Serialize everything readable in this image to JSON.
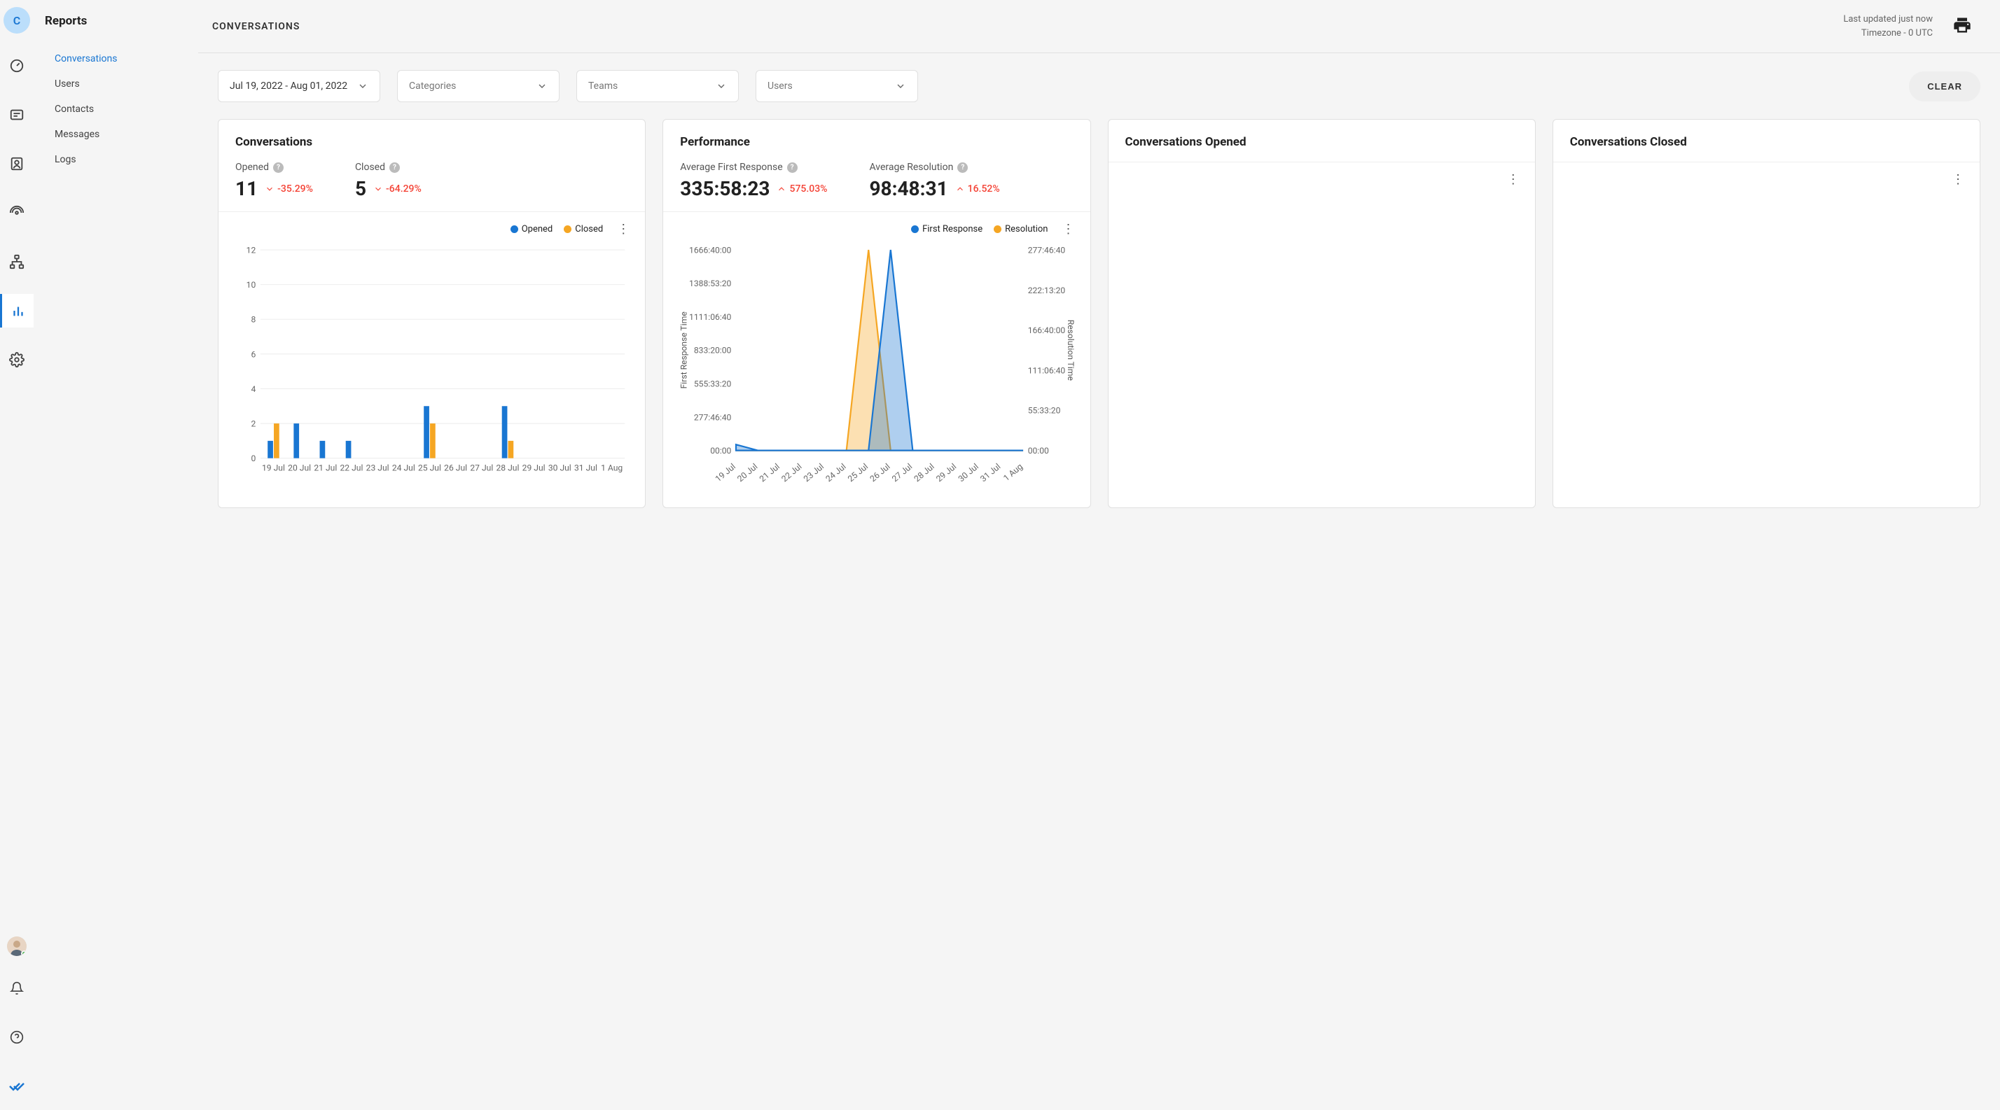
{
  "avatar_letter": "C",
  "sidebar_title": "Reports",
  "sidebar_items": [
    "Conversations",
    "Users",
    "Contacts",
    "Messages",
    "Logs"
  ],
  "page_title": "CONVERSATIONS",
  "header": {
    "updated": "Last updated just now",
    "timezone": "Timezone - 0 UTC"
  },
  "filters": {
    "date_range": "Jul 19, 2022 - Aug 01, 2022",
    "categories": "Categories",
    "teams": "Teams",
    "users": "Users",
    "clear_label": "CLEAR"
  },
  "conversations_card": {
    "title": "Conversations",
    "opened_label": "Opened",
    "opened_value": "11",
    "opened_delta": "-35.29%",
    "opened_dir": "down",
    "closed_label": "Closed",
    "closed_value": "5",
    "closed_delta": "-64.29%",
    "closed_dir": "down",
    "legend_opened": "Opened",
    "legend_closed": "Closed"
  },
  "performance_card": {
    "title": "Performance",
    "afr_label": "Average First Response",
    "afr_value": "335:58:23",
    "afr_delta": "575.03%",
    "afr_dir": "up",
    "ar_label": "Average Resolution",
    "ar_value": "98:48:31",
    "ar_delta": "16.52%",
    "ar_dir": "up",
    "legend_fr": "First Response",
    "legend_res": "Resolution",
    "y_left_title": "First Response Time",
    "y_right_title": "Resolution Time"
  },
  "card3_title": "Conversations Opened",
  "card4_title": "Conversations Closed",
  "colors": {
    "blue": "#1976d2",
    "orange": "#f5a623",
    "red": "#f44336"
  },
  "chart_data": [
    {
      "type": "bar",
      "title": "Conversations",
      "categories": [
        "19 Jul",
        "20 Jul",
        "21 Jul",
        "22 Jul",
        "23 Jul",
        "24 Jul",
        "25 Jul",
        "26 Jul",
        "27 Jul",
        "28 Jul",
        "29 Jul",
        "30 Jul",
        "31 Jul",
        "1 Aug"
      ],
      "series": [
        {
          "name": "Opened",
          "color": "#1976d2",
          "values": [
            1,
            2,
            1,
            1,
            0,
            0,
            3,
            0,
            0,
            3,
            0,
            0,
            0,
            0
          ]
        },
        {
          "name": "Closed",
          "color": "#f5a623",
          "values": [
            2,
            0,
            0,
            0,
            0,
            0,
            2,
            0,
            0,
            1,
            0,
            0,
            0,
            0
          ]
        }
      ],
      "ylim": [
        0,
        12
      ],
      "yticks": [
        0,
        2,
        4,
        6,
        8,
        10,
        12
      ]
    },
    {
      "type": "area",
      "title": "Performance",
      "categories": [
        "19 Jul",
        "20 Jul",
        "21 Jul",
        "22 Jul",
        "23 Jul",
        "24 Jul",
        "25 Jul",
        "26 Jul",
        "27 Jul",
        "28 Jul",
        "29 Jul",
        "30 Jul",
        "31 Jul",
        "1 Aug"
      ],
      "series": [
        {
          "name": "First Response",
          "axis": "left",
          "color": "#1976d2",
          "values": [
            50,
            0,
            0,
            0,
            0,
            0,
            0,
            1700,
            0,
            0,
            0,
            0,
            0,
            0
          ]
        },
        {
          "name": "Resolution",
          "axis": "right",
          "color": "#f5a623",
          "values": [
            0,
            0,
            0,
            0,
            0,
            0,
            280,
            0,
            0,
            0,
            0,
            0,
            0,
            0
          ]
        }
      ],
      "y_left_ticks": [
        "00:00",
        "277:46:40",
        "555:33:20",
        "833:20:00",
        "1111:06:40",
        "1388:53:20",
        "1666:40:00"
      ],
      "y_right_ticks": [
        "00:00",
        "55:33:20",
        "111:06:40",
        "166:40:00",
        "222:13:20",
        "277:46:40"
      ]
    }
  ]
}
